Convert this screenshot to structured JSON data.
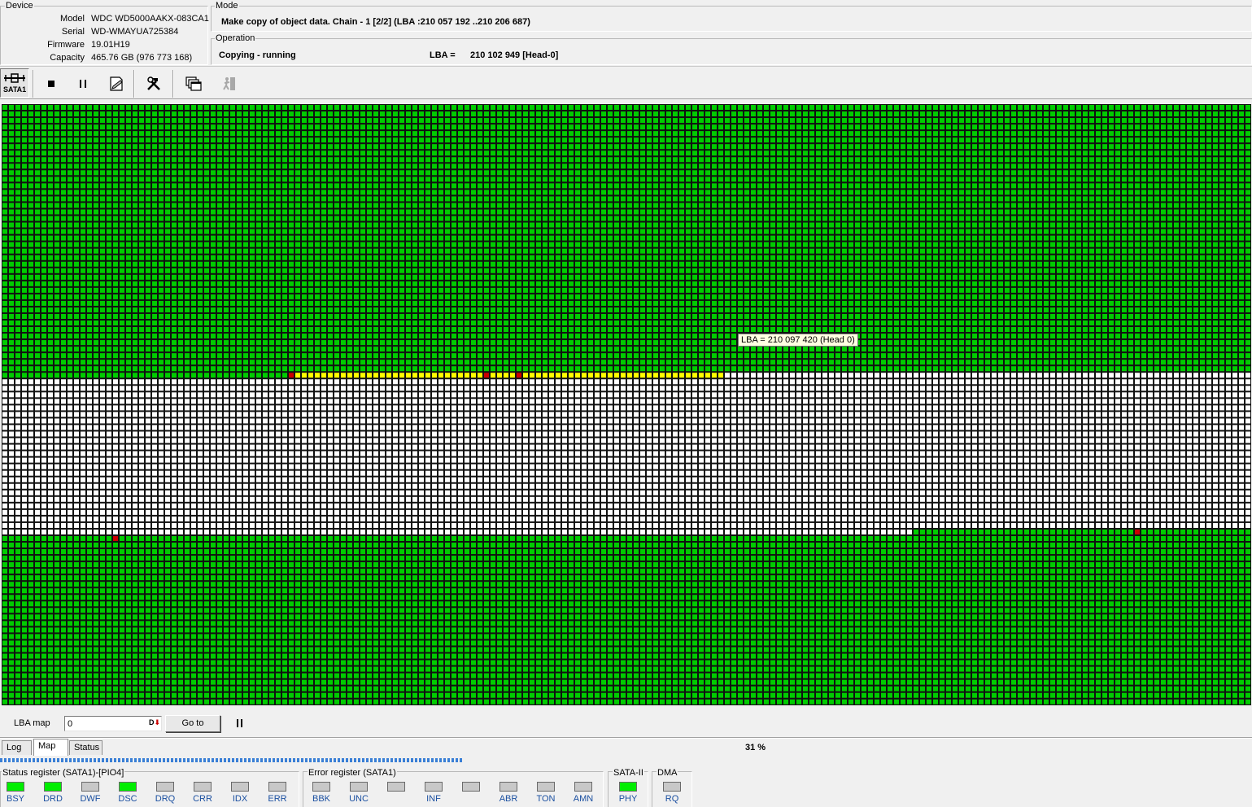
{
  "device": {
    "group_title": "Device",
    "rows": [
      {
        "label": "Model",
        "value": "WDC WD5000AAKX-083CA1"
      },
      {
        "label": "Serial",
        "value": "WD-WMAYUA725384"
      },
      {
        "label": "Firmware",
        "value": "19.01H19"
      },
      {
        "label": "Capacity",
        "value": "465.76 GB (976 773 168)"
      }
    ]
  },
  "mode": {
    "group_title": "Mode",
    "text": "Make copy of object data. Chain - 1 [2/2] (LBA :210 057 192 ..210 206 687)"
  },
  "operation": {
    "group_title": "Operation",
    "status": "Copying - running",
    "lba_label": "LBA =",
    "lba_value": "210 102 949  [Head-0]"
  },
  "toolbar": {
    "interface_label": "SATA1",
    "buttons": [
      "stop-icon",
      "pause-icon",
      "edit-document-icon",
      "tools-icon",
      "copy-windows-icon",
      "exit-icon"
    ]
  },
  "map": {
    "tooltip": "LBA =  210 097 420 (Head 0)",
    "colors": {
      "good": "#00cc00",
      "empty": "#ffffff",
      "current": "#ffff00",
      "bad": "#cc0000",
      "grid": "#111111"
    }
  },
  "lba_bar": {
    "label": "LBA map",
    "input_value": "0",
    "goto_label": "Go to",
    "pause_icon": "pause-icon"
  },
  "tabs": [
    {
      "label": "Log",
      "active": false
    },
    {
      "label": "Map",
      "active": true
    },
    {
      "label": "Status",
      "active": false
    }
  ],
  "progress": {
    "percent_text": "31 %",
    "value": 0.31
  },
  "status_register": {
    "title": "Status register (SATA1)-[PIO4]",
    "leds": [
      {
        "label": "BSY",
        "on": true
      },
      {
        "label": "DRD",
        "on": true
      },
      {
        "label": "DWF",
        "on": false
      },
      {
        "label": "DSC",
        "on": true
      },
      {
        "label": "DRQ",
        "on": false
      },
      {
        "label": "CRR",
        "on": false
      },
      {
        "label": "IDX",
        "on": false
      },
      {
        "label": "ERR",
        "on": false
      }
    ]
  },
  "error_register": {
    "title": "Error register (SATA1)",
    "leds": [
      {
        "label": "BBK",
        "on": false
      },
      {
        "label": "UNC",
        "on": false
      },
      {
        "label": "",
        "on": false
      },
      {
        "label": "INF",
        "on": false
      },
      {
        "label": "",
        "on": false
      },
      {
        "label": "ABR",
        "on": false
      },
      {
        "label": "TON",
        "on": false
      },
      {
        "label": "AMN",
        "on": false
      }
    ]
  },
  "sata_register": {
    "title": "SATA-II",
    "leds": [
      {
        "label": "PHY",
        "on": true
      }
    ]
  },
  "dma_register": {
    "title": "DMA",
    "leds": [
      {
        "label": "RQ",
        "on": false
      }
    ]
  }
}
